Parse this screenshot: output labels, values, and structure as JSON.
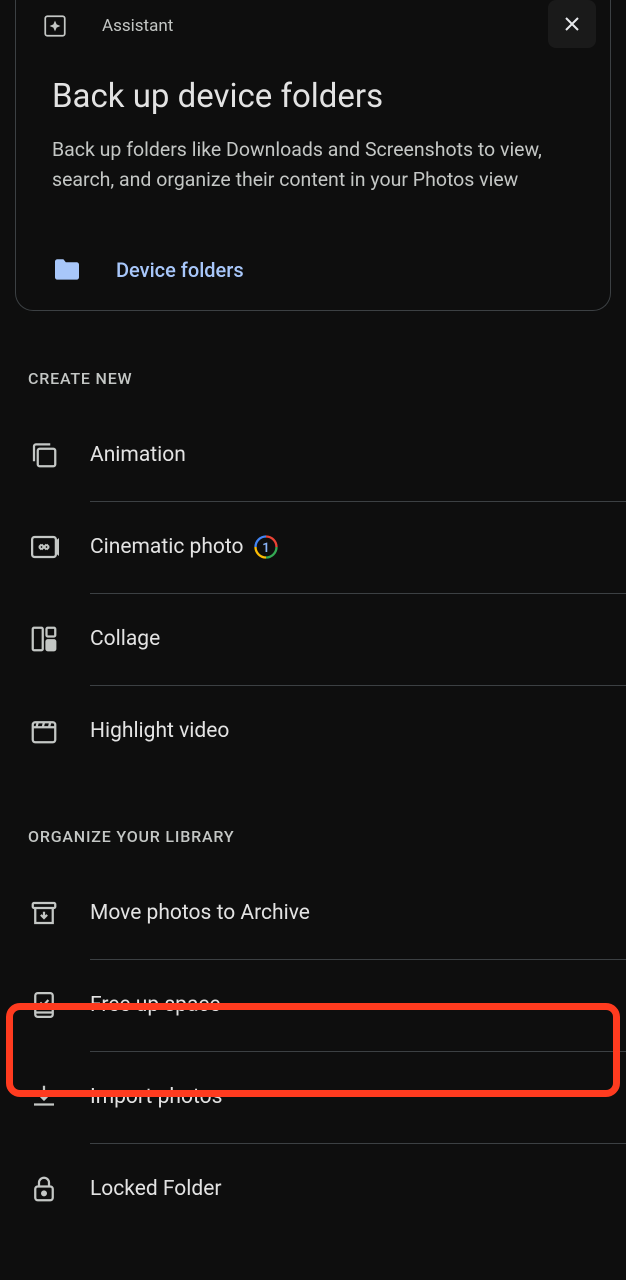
{
  "assistant_card": {
    "header_label": "Assistant",
    "title": "Back up device folders",
    "description": "Back up folders like Downloads and Screenshots to view, search, and organize their content in your Photos view",
    "action_label": "Device folders"
  },
  "sections": {
    "create_new": {
      "header": "CREATE NEW",
      "items": [
        {
          "label": "Animation",
          "icon": "animation"
        },
        {
          "label": "Cinematic photo",
          "icon": "cinematic",
          "badge": true
        },
        {
          "label": "Collage",
          "icon": "collage"
        },
        {
          "label": "Highlight video",
          "icon": "highlight"
        }
      ]
    },
    "organize": {
      "header": "ORGANIZE YOUR LIBRARY",
      "items": [
        {
          "label": "Move photos to Archive",
          "icon": "archive"
        },
        {
          "label": "Free up space",
          "icon": "free-space"
        },
        {
          "label": "Import photos",
          "icon": "import"
        },
        {
          "label": "Locked Folder",
          "icon": "locked"
        }
      ]
    }
  }
}
